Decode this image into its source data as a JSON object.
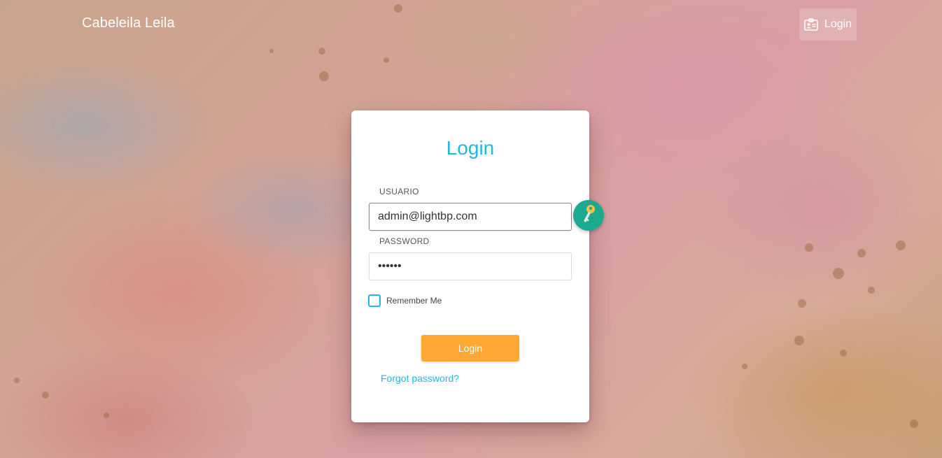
{
  "header": {
    "brand": "Cabeleila Leila",
    "nav_login_label": "Login",
    "nav_login_icon": "id-card-icon"
  },
  "login_form": {
    "title": "Login",
    "username_label": "USUARIO",
    "username_value": "admin@lightbp.com",
    "password_label": "PASSWORD",
    "password_value": "••••••",
    "remember_label": "Remember Me",
    "remember_checked": false,
    "submit_label": "Login",
    "forgot_label": "Forgot password?",
    "autofill_icon": "key-icon"
  },
  "colors": {
    "accent": "#1fb9e0",
    "button": "#ffa733",
    "key_badge": "#1aaa8f"
  }
}
